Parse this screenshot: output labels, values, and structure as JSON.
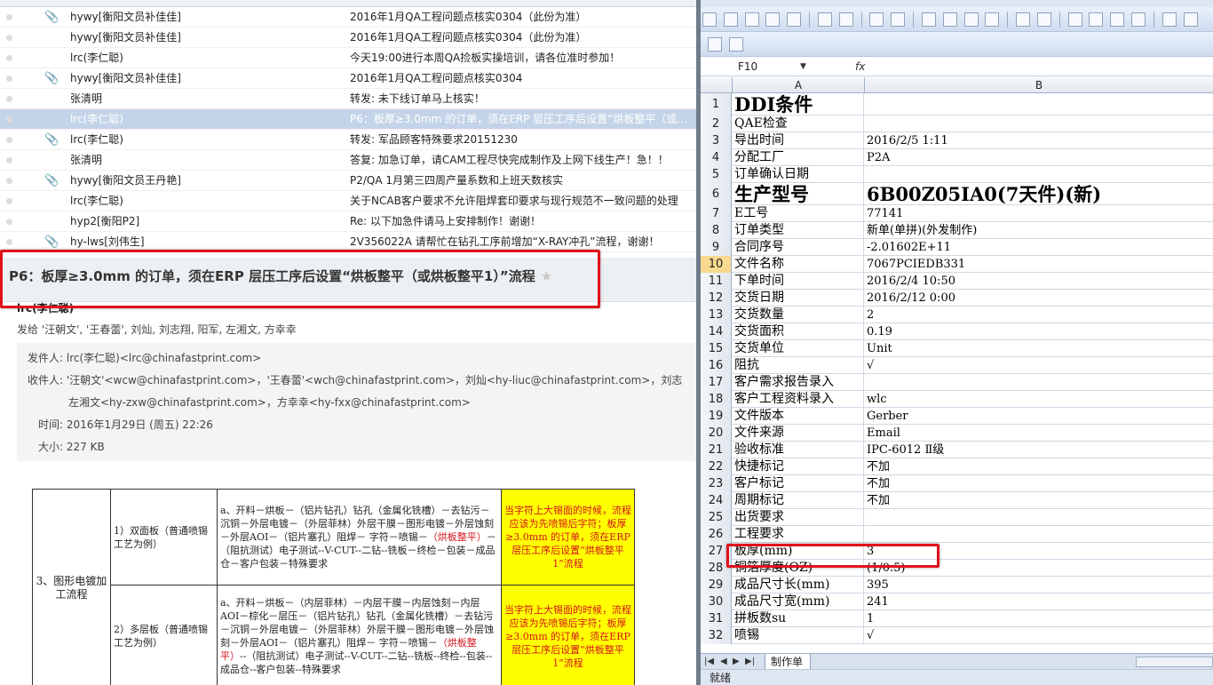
{
  "mail_list": [
    {
      "from": "hywy[衡阳文员补佳佳]",
      "subject": "2016年1月QA工程问题点核实0304（此份为准）",
      "attachment": true,
      "selected": false
    },
    {
      "from": "hywy[衡阳文员补佳佳]",
      "subject": "2016年1月QA工程问题点核实0304（此份为准）",
      "attachment": false,
      "selected": false
    },
    {
      "from": "lrc(李仁聪)",
      "subject": "今天19:00进行本周QA捡板实操培训，请各位准时参加！",
      "attachment": false,
      "selected": false
    },
    {
      "from": "hywy[衡阳文员补佳佳]",
      "subject": "2016年1月QA工程问题点核实0304",
      "attachment": true,
      "selected": false
    },
    {
      "from": "张清明",
      "subject": "转发: 未下线订单马上核实！",
      "attachment": false,
      "selected": false
    },
    {
      "from": "lrc(李仁聪)",
      "subject": "P6：板厚≥3.0mm 的订单，须在ERP 层压工序后设置“烘板整平（或烘板整平1）”流程",
      "attachment": false,
      "selected": true
    },
    {
      "from": "lrc(李仁聪)",
      "subject": "转发: 军品顾客特殊要求20151230",
      "attachment": true,
      "selected": false
    },
    {
      "from": "张清明",
      "subject": "答复: 加急订单，请CAM工程尽快完成制作及上网下线生产！急！！",
      "attachment": false,
      "selected": false
    },
    {
      "from": "hywy[衡阳文员王丹艳]",
      "subject": "P2/QA 1月第三四周产量系数和上班天数核实",
      "attachment": true,
      "selected": false
    },
    {
      "from": "lrc(李仁聪)",
      "subject": "关于NCAB客户要求不允许阻焊套印要求与现行规范不一致问题的处理",
      "attachment": false,
      "selected": false
    },
    {
      "from": "hyp2[衡阳P2]",
      "subject": "Re: 以下加急件请马上安排制作！谢谢！",
      "attachment": false,
      "selected": false
    },
    {
      "from": "hy-lws[刘伟生]",
      "subject": "2V356022A 请帮忙在钻孔工序前增加“X-RAY冲孔”流程，谢谢！",
      "attachment": true,
      "selected": false
    }
  ],
  "reading": {
    "subject": "P6：板厚≥3.0mm 的订单，须在ERP 层压工序后设置“烘板整平（或烘板整平1）”流程",
    "star": "★",
    "sender_name": "lrc(李仁聪)",
    "sent_to": "发给 '汪朝文', '王春蕾', 刘灿, 刘志翔, 阳军, 左湘文, 方幸幸",
    "from_label": "发件人:",
    "from_value": "lrc(李仁聪)<lrc@chinafastprint.com>",
    "to_label": "收件人:",
    "to_value_1": "'汪朝文'<wcw@chinafastprint.com>，'王春蕾'<wch@chinafastprint.com>，刘灿<hy-liuc@chinafastprint.com>，刘志",
    "to_value_2": "左湘文<hy-zxw@chinafastprint.com>，方幸幸<hy-fxx@chinafastprint.com>",
    "time_label": "时间:",
    "time_value": "2016年1月29日 (周五) 22:26",
    "size_label": "大小:",
    "size_value": "227 KB"
  },
  "flow_table": {
    "category": "3、图形电镀加工流程",
    "rows": [
      {
        "type": "1）双面板（普通喷锡工艺为例）",
        "flow_before": "a、开料－烘板－（铝片钻孔）钻孔（金属化铣槽）－去钻污－沉铜－外层电镀－（外层菲林）外层干膜－图形电镀－外层蚀刻－外层AOI－（铝片塞孔）阻焊－ 字符－喷锡－",
        "flow_red": "（烘板整平）",
        "flow_after": "－（阻抗测试）电子测试--V-CUT--二钻--铣板－终检－包装－成品仓－客户包装－特殊要求",
        "note_black": "当字符上大锡面的时候，流程应该为先喷锡后字符；",
        "note_red": "板厚≥3.0mm 的订单，须在ERP 层压工序后设置“烘板整平1”流程"
      },
      {
        "type": "2）多层板（普通喷锡工艺为例）",
        "flow_before": "a、开料－烘板－（内层菲林）－内层干膜－内层蚀刻－内层AOI－棕化－层压－（铝片钻孔）钻孔（金属化铣槽）－去钻污－沉铜－外层电镀－（外层菲林）外层干膜－图形电镀－外层蚀刻－外层AOI－（铝片塞孔）阻焊－ 字符－喷锡－",
        "flow_red": "（烘板整平）",
        "flow_after": "--（阻抗测试）电子测试--V-CUT--二钻--铣板--终检--包装--成品仓--客户包装--特殊要求",
        "note_black": "当字符上大锡面的时候，流程应该为先喷锡后字符；",
        "note_red": "板厚≥3.0mm 的订单，须在ERP 层压工序后设置“烘板整平1”流程"
      }
    ]
  },
  "excel": {
    "name_box": "F10",
    "fx": "fx",
    "columns": [
      "A",
      "B"
    ],
    "rows": [
      {
        "n": "1",
        "a": "DDI条件",
        "b": "",
        "big": true
      },
      {
        "n": "2",
        "a": "QAE检查",
        "b": ""
      },
      {
        "n": "3",
        "a": "导出时间",
        "b": "2016/2/5 1:11"
      },
      {
        "n": "4",
        "a": "分配工厂",
        "b": "P2A"
      },
      {
        "n": "5",
        "a": "订单确认日期",
        "b": ""
      },
      {
        "n": "6",
        "a": "生产型号",
        "b": "6B00Z05IA0(7天件)(新)",
        "big": true
      },
      {
        "n": "7",
        "a": "E工号",
        "b": "77141"
      },
      {
        "n": "8",
        "a": "订单类型",
        "b": "新单(单拼)(外发制作)"
      },
      {
        "n": "9",
        "a": "合同序号",
        "b": "-2.01602E+11"
      },
      {
        "n": "10",
        "a": "文件名称",
        "b": "7067PCIEDB331",
        "active": true
      },
      {
        "n": "11",
        "a": "下单时间",
        "b": "2016/2/4 10:50"
      },
      {
        "n": "12",
        "a": "交货日期",
        "b": "2016/2/12 0:00"
      },
      {
        "n": "13",
        "a": "交货数量",
        "b": "2"
      },
      {
        "n": "14",
        "a": "交货面积",
        "b": "0.19"
      },
      {
        "n": "15",
        "a": "交货单位",
        "b": "Unit"
      },
      {
        "n": "16",
        "a": "阻抗",
        "b": "√"
      },
      {
        "n": "17",
        "a": "客户需求报告录入",
        "b": ""
      },
      {
        "n": "18",
        "a": "客户工程资料录入",
        "b": "wlc"
      },
      {
        "n": "19",
        "a": "文件版本",
        "b": "Gerber"
      },
      {
        "n": "20",
        "a": "文件来源",
        "b": "Email"
      },
      {
        "n": "21",
        "a": "验收标准",
        "b": "IPC-6012 Ⅱ级"
      },
      {
        "n": "22",
        "a": "快捷标记",
        "b": "不加"
      },
      {
        "n": "23",
        "a": "客户标记",
        "b": "不加"
      },
      {
        "n": "24",
        "a": "周期标记",
        "b": "不加"
      },
      {
        "n": "25",
        "a": "出货要求",
        "b": ""
      },
      {
        "n": "26",
        "a": "工程要求",
        "b": ""
      },
      {
        "n": "27",
        "a": "板厚(mm)",
        "b": "3"
      },
      {
        "n": "28",
        "a": "铜箔厚度(OZ)",
        "b": "(1/0.5)"
      },
      {
        "n": "29",
        "a": "成品尺寸长(mm)",
        "b": "395"
      },
      {
        "n": "30",
        "a": "成品尺寸宽(mm)",
        "b": "241"
      },
      {
        "n": "31",
        "a": "拼板数su",
        "b": "1"
      },
      {
        "n": "32",
        "a": "喷锡",
        "b": "√"
      }
    ],
    "sheet_tab": "制作单",
    "status": "就绪"
  }
}
